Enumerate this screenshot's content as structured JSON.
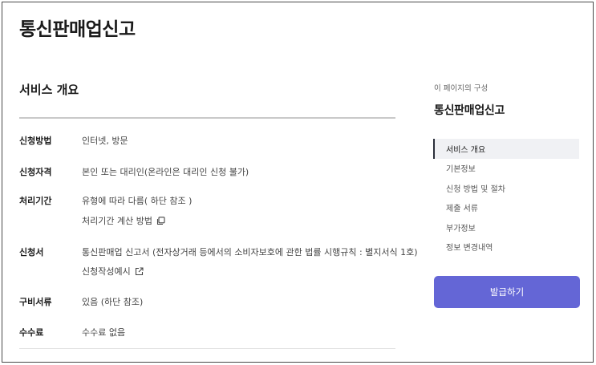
{
  "page": {
    "title": "통신판매업신고"
  },
  "section": {
    "title": "서비스 개요"
  },
  "rows": [
    {
      "label": "신청방법",
      "value": "인터넷, 방문"
    },
    {
      "label": "신청자격",
      "value": "본인 또는 대리인(온라인은 대리인 신청 불가)"
    },
    {
      "label": "처리기간",
      "value": "유형에 따라 다름( 하단 참조 )",
      "link": "처리기간 계산 방법",
      "link_icon": "copy-icon"
    },
    {
      "label": "신청서",
      "value": "통신판매업 신고서 (전자상거래 등에서의 소비자보호에 관한 법률 시행규칙 : 별지서식 1호)",
      "link": "신청작성예시",
      "link_icon": "external-link-icon"
    },
    {
      "label": "구비서류",
      "value": "있음 (하단 참조)"
    },
    {
      "label": "수수료",
      "value": "수수료 없음"
    }
  ],
  "toc": {
    "caption": "이 페이지의 구성",
    "title": "통신판매업신고",
    "items": [
      {
        "label": "서비스 개요",
        "active": true
      },
      {
        "label": "기본정보"
      },
      {
        "label": "신청 방법 및 절차"
      },
      {
        "label": "제출 서류"
      },
      {
        "label": "부가정보"
      },
      {
        "label": "정보 변경내역"
      }
    ]
  },
  "actions": {
    "issue_label": "발급하기"
  },
  "colors": {
    "accent_button": "#6466d6",
    "active_marker": "#2b2f3a",
    "active_bg": "#f0f1f4"
  }
}
